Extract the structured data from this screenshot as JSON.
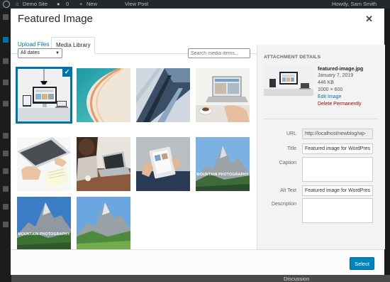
{
  "adminbar": {
    "site": "Demo Site",
    "comments": "0",
    "new_label": "New",
    "view_post": "View Post",
    "howdy": "Howdy, Sam Smith"
  },
  "backdrop": {
    "discussion": "Discussion"
  },
  "modal": {
    "title": "Featured Image",
    "close_icon": "close-icon"
  },
  "tabs": [
    {
      "label": "Upload Files",
      "active": false
    },
    {
      "label": "Media Library",
      "active": true
    }
  ],
  "toolbar": {
    "date_filter": "All dates",
    "search_placeholder": "Search media items..."
  },
  "media_items": [
    {
      "kind": "desk-devices",
      "selected": true,
      "label": ""
    },
    {
      "kind": "teal-curve",
      "selected": false,
      "label": ""
    },
    {
      "kind": "skyscraper",
      "selected": false,
      "label": ""
    },
    {
      "kind": "laptop-coffee",
      "selected": false,
      "label": ""
    },
    {
      "kind": "laptop-notebook",
      "selected": false,
      "label": ""
    },
    {
      "kind": "woman-laptop",
      "selected": false,
      "label": ""
    },
    {
      "kind": "hands-tablet",
      "selected": false,
      "label": ""
    },
    {
      "kind": "mountain",
      "selected": false,
      "label": "MOUNTAIN PHOTOGRAPHY"
    },
    {
      "kind": "mountain",
      "selected": false,
      "label": "MOUNTAIN PHOTOGRAPHY"
    },
    {
      "kind": "mountain-green",
      "selected": false,
      "label": ""
    }
  ],
  "attachment": {
    "heading": "ATTACHMENT DETAILS",
    "filename": "featured-image.jpg",
    "date": "January 7, 2019",
    "size": "446 KB",
    "dimensions": "1000 × 600",
    "edit_label": "Edit Image",
    "delete_label": "Delete Permanently"
  },
  "fields": {
    "url_label": "URL",
    "url_value": "http://localhost/newblog/wp-",
    "title_label": "Title",
    "title_value": "Featured image for WordPres",
    "caption_label": "Caption",
    "caption_value": "",
    "alt_label": "Alt Text",
    "alt_value": "Featured image for WordPres",
    "description_label": "Description",
    "description_value": ""
  },
  "footer": {
    "select_label": "Select"
  },
  "colors": {
    "accent": "#0073aa",
    "button": "#0085ba",
    "delete": "#aa0000"
  }
}
